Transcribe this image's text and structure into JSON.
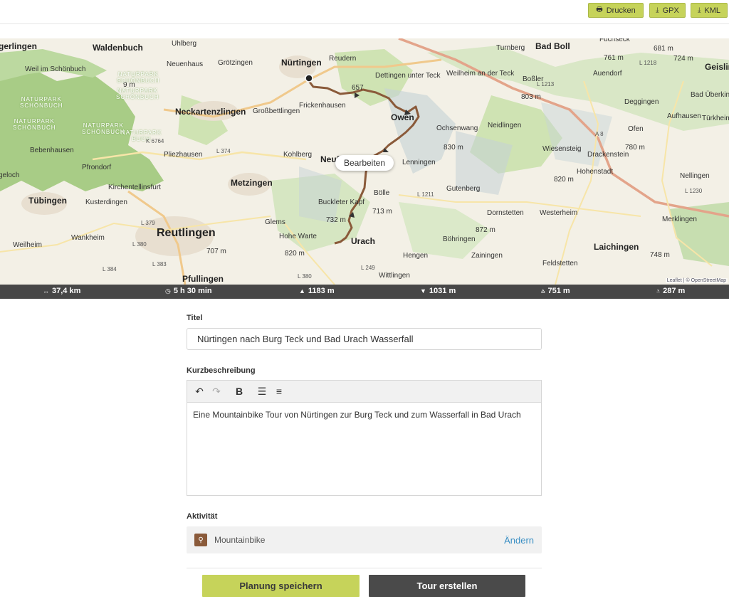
{
  "toolbar": {
    "print_label": "Drucken",
    "gpx_label": "GPX",
    "kml_label": "KML"
  },
  "map": {
    "places": [
      {
        "name": "Waldenbuch",
        "cls": "big"
      },
      {
        "name": "Nürtingen",
        "cls": "big"
      },
      {
        "name": "Bad Boll",
        "cls": "big"
      },
      {
        "name": "Neckartenzlingen",
        "cls": "big"
      },
      {
        "name": "Metzingen",
        "cls": "big"
      },
      {
        "name": "Tübingen",
        "cls": "big"
      },
      {
        "name": "Reutlingen",
        "cls": "huge"
      },
      {
        "name": "Pfullingen",
        "cls": "big"
      },
      {
        "name": "Laichingen",
        "cls": "big"
      },
      {
        "name": "Geislin",
        "cls": "big"
      },
      {
        "name": "gerlingen",
        "cls": "big"
      },
      {
        "name": "Owen",
        "cls": "big"
      },
      {
        "name": "Neuf",
        "cls": "big"
      },
      {
        "name": "Urach",
        "cls": "big"
      },
      {
        "name": "Weil im Schönbuch",
        "cls": ""
      },
      {
        "name": "Uhlberg",
        "cls": ""
      },
      {
        "name": "Neuenhaus",
        "cls": ""
      },
      {
        "name": "Grötzingen",
        "cls": ""
      },
      {
        "name": "Reudern",
        "cls": ""
      },
      {
        "name": "Turnberg",
        "cls": ""
      },
      {
        "name": "Fuchseck",
        "cls": ""
      },
      {
        "name": "761 m",
        "cls": ""
      },
      {
        "name": "681 m",
        "cls": ""
      },
      {
        "name": "724 m",
        "cls": ""
      },
      {
        "name": "Auendorf",
        "cls": ""
      },
      {
        "name": "Dettingen unter Teck",
        "cls": ""
      },
      {
        "name": "Weilheim an der Teck",
        "cls": ""
      },
      {
        "name": "Boßler",
        "cls": ""
      },
      {
        "name": "803 m",
        "cls": ""
      },
      {
        "name": "Bad Überkinge",
        "cls": ""
      },
      {
        "name": "Großbettlingen",
        "cls": ""
      },
      {
        "name": "Frickenhausen",
        "cls": ""
      },
      {
        "name": "Ochsenwang",
        "cls": ""
      },
      {
        "name": "Neidlingen",
        "cls": ""
      },
      {
        "name": "Deggingen",
        "cls": ""
      },
      {
        "name": "Aufhausen",
        "cls": ""
      },
      {
        "name": "Türkheim",
        "cls": ""
      },
      {
        "name": "Bebenhausen",
        "cls": ""
      },
      {
        "name": "Pliezhausen",
        "cls": ""
      },
      {
        "name": "Kohlberg",
        "cls": ""
      },
      {
        "name": "830 m",
        "cls": ""
      },
      {
        "name": "Ofen",
        "cls": ""
      },
      {
        "name": "780 m",
        "cls": ""
      },
      {
        "name": "Wiesensteig",
        "cls": ""
      },
      {
        "name": "Drackenstein",
        "cls": ""
      },
      {
        "name": "Pfrondorf",
        "cls": ""
      },
      {
        "name": "Lenningen",
        "cls": ""
      },
      {
        "name": "Hohenstadt",
        "cls": ""
      },
      {
        "name": "geloch",
        "cls": ""
      },
      {
        "name": "Kirchentellinsfurt",
        "cls": ""
      },
      {
        "name": "820 m",
        "cls": ""
      },
      {
        "name": "Nellingen",
        "cls": ""
      },
      {
        "name": "Kusterdingen",
        "cls": ""
      },
      {
        "name": "Bölle",
        "cls": ""
      },
      {
        "name": "Gutenberg",
        "cls": ""
      },
      {
        "name": "Buckleter Kapf",
        "cls": ""
      },
      {
        "name": "713 m",
        "cls": ""
      },
      {
        "name": "Dornstetten",
        "cls": ""
      },
      {
        "name": "Westerheim",
        "cls": ""
      },
      {
        "name": "732 m",
        "cls": ""
      },
      {
        "name": "Glems",
        "cls": ""
      },
      {
        "name": "Merklingen",
        "cls": ""
      },
      {
        "name": "Wankheim",
        "cls": ""
      },
      {
        "name": "872 m",
        "cls": ""
      },
      {
        "name": "Hohe Warte",
        "cls": ""
      },
      {
        "name": "Böhringen",
        "cls": ""
      },
      {
        "name": "Weilheim",
        "cls": ""
      },
      {
        "name": "707 m",
        "cls": ""
      },
      {
        "name": "820 m",
        "cls": ""
      },
      {
        "name": "Hengen",
        "cls": ""
      },
      {
        "name": "Zainingen",
        "cls": ""
      },
      {
        "name": "748 m",
        "cls": ""
      },
      {
        "name": "Feldstetten",
        "cls": ""
      },
      {
        "name": "Wittlingen",
        "cls": ""
      },
      {
        "name": "657",
        "cls": ""
      },
      {
        "name": "9 m",
        "cls": ""
      }
    ],
    "parks": [
      "NATURPARK\nSCHÖNBUCH",
      "NATURPARK\nSCHÖNBUCH",
      "NATURPARK\nSCHÖNBUCH",
      "NATURPARK\nSCHÖNBUCH",
      "NATURPARK\nSCHÖNBUCH",
      "NATURPARK\nBUCH"
    ],
    "roads": [
      "L 374",
      "L 1213",
      "L 1218",
      "L 1211",
      "L 1230",
      "L 379",
      "L 380",
      "L 384",
      "L 383",
      "L 380",
      "L 249",
      "K 6764",
      "A 8"
    ],
    "edit_label": "Bearbeiten",
    "attribution": "Leaflet | © OpenStreetMap"
  },
  "stats": {
    "distance": "37,4 km",
    "duration": "5 h 30 min",
    "ascent": "1183 m",
    "descent": "1031 m",
    "max_alt": "751 m",
    "min_alt": "287 m"
  },
  "form": {
    "title_label": "Titel",
    "title_value": "Nürtingen nach Burg Teck und Bad Urach Wasserfall",
    "desc_label": "Kurzbeschreibung",
    "desc_value": "Eine Mountainbike Tour von Nürtingen zur Burg Teck und zum Wasserfall in Bad Urach",
    "activity_label": "Aktivität",
    "activity_value": "Mountainbike",
    "activity_change": "Ändern",
    "save_label": "Planung speichern",
    "create_label": "Tour erstellen"
  }
}
